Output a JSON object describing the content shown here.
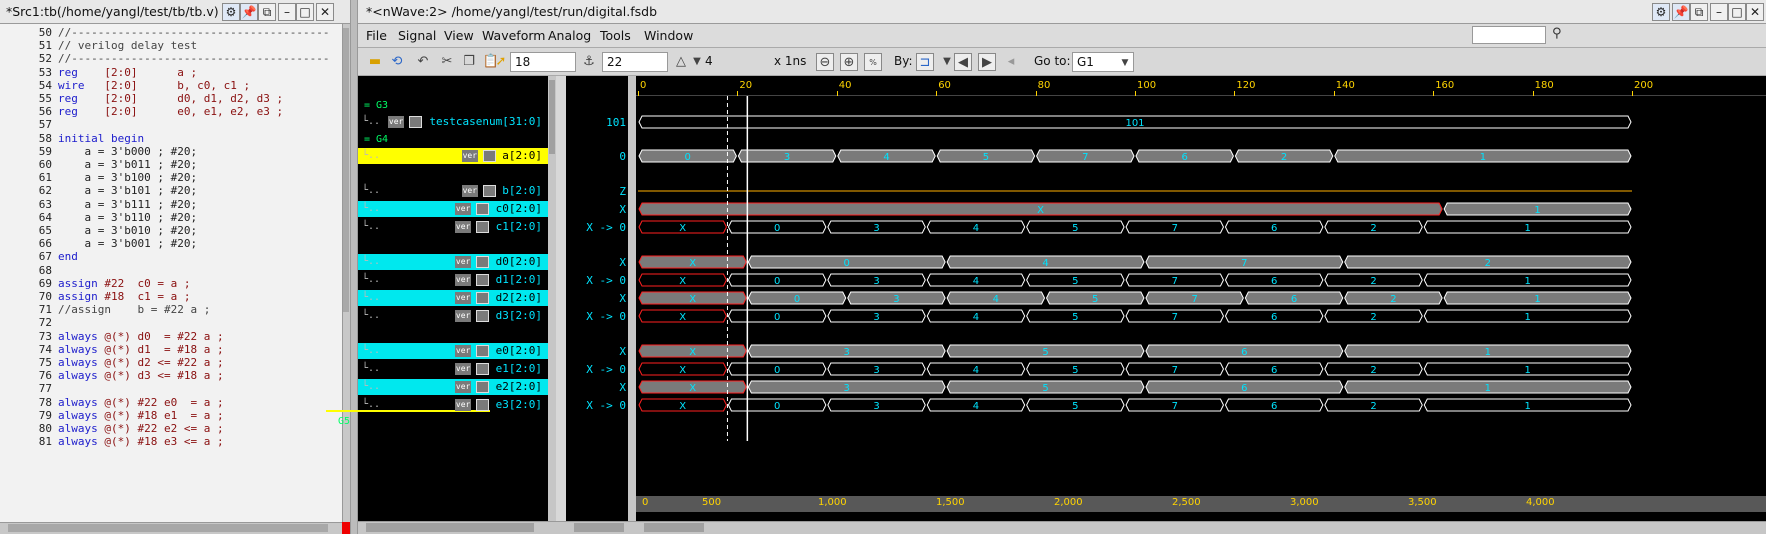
{
  "source_window": {
    "title": "*Src1:tb(/home/yangl/test/tb/tb.v)",
    "lines": [
      {
        "num": "50",
        "segments": [
          {
            "t": "//---------------------------------------",
            "c": "cm"
          }
        ]
      },
      {
        "num": "51",
        "segments": [
          {
            "t": "// verilog delay test",
            "c": "cm"
          }
        ]
      },
      {
        "num": "52",
        "segments": [
          {
            "t": "//---------------------------------------",
            "c": "cm"
          }
        ]
      },
      {
        "num": "53",
        "segments": [
          {
            "t": "reg",
            "c": "kw"
          },
          {
            "t": "    [2:0]      a ;",
            "c": "tx"
          }
        ]
      },
      {
        "num": "54",
        "segments": [
          {
            "t": "wire",
            "c": "kw"
          },
          {
            "t": "   [2:0]      b, c0, c1 ;",
            "c": "tx"
          }
        ]
      },
      {
        "num": "55",
        "segments": [
          {
            "t": "reg",
            "c": "kw"
          },
          {
            "t": "    [2:0]      d0, d1, d2, d3 ;",
            "c": "tx"
          }
        ]
      },
      {
        "num": "56",
        "segments": [
          {
            "t": "reg",
            "c": "kw"
          },
          {
            "t": "    [2:0]      e0, e1, e2, e3 ;",
            "c": "tx"
          }
        ]
      },
      {
        "num": "57",
        "segments": []
      },
      {
        "num": "58",
        "segments": [
          {
            "t": "initial begin",
            "c": "kw"
          }
        ]
      },
      {
        "num": "59",
        "segments": [
          {
            "t": "    a = 3'b000 ; #20;",
            "c": "nm"
          }
        ]
      },
      {
        "num": "60",
        "segments": [
          {
            "t": "    a = 3'b011 ; #20;",
            "c": "nm"
          }
        ]
      },
      {
        "num": "61",
        "segments": [
          {
            "t": "    a = 3'b100 ; #20;",
            "c": "nm"
          }
        ]
      },
      {
        "num": "62",
        "segments": [
          {
            "t": "    a = 3'b101 ; #20;",
            "c": "nm"
          }
        ]
      },
      {
        "num": "63",
        "segments": [
          {
            "t": "    a = 3'b111 ; #20;",
            "c": "nm"
          }
        ]
      },
      {
        "num": "64",
        "segments": [
          {
            "t": "    a = 3'b110 ; #20;",
            "c": "nm"
          }
        ]
      },
      {
        "num": "65",
        "segments": [
          {
            "t": "    a = 3'b010 ; #20;",
            "c": "nm"
          }
        ]
      },
      {
        "num": "66",
        "segments": [
          {
            "t": "    a = 3'b001 ; #20;",
            "c": "nm"
          }
        ]
      },
      {
        "num": "67",
        "segments": [
          {
            "t": "end",
            "c": "kw"
          }
        ]
      },
      {
        "num": "68",
        "segments": []
      },
      {
        "num": "69",
        "segments": [
          {
            "t": "assign",
            "c": "kw"
          },
          {
            "t": " #22  c0 = a ;",
            "c": "tx"
          }
        ]
      },
      {
        "num": "70",
        "segments": [
          {
            "t": "assign",
            "c": "kw"
          },
          {
            "t": " #18  c1 = a ;",
            "c": "tx"
          }
        ]
      },
      {
        "num": "71",
        "segments": [
          {
            "t": "//assign    b = #22 a ;",
            "c": "cm"
          }
        ]
      },
      {
        "num": "72",
        "segments": []
      },
      {
        "num": "73",
        "segments": [
          {
            "t": "always",
            "c": "kw"
          },
          {
            "t": " @(*) d0  = #22 a ;",
            "c": "tx"
          }
        ]
      },
      {
        "num": "74",
        "segments": [
          {
            "t": "always",
            "c": "kw"
          },
          {
            "t": " @(*) d1  = #18 a ;",
            "c": "tx"
          }
        ]
      },
      {
        "num": "75",
        "segments": [
          {
            "t": "always",
            "c": "kw"
          },
          {
            "t": " @(*) d2 <= #22 a ;",
            "c": "tx"
          }
        ]
      },
      {
        "num": "76",
        "segments": [
          {
            "t": "always",
            "c": "kw"
          },
          {
            "t": " @(*) d3 <= #18 a ;",
            "c": "tx"
          }
        ]
      },
      {
        "num": "77",
        "segments": []
      },
      {
        "num": "78",
        "segments": [
          {
            "t": "always",
            "c": "kw"
          },
          {
            "t": " @(*) #22 e0  = a ;",
            "c": "tx"
          }
        ]
      },
      {
        "num": "79",
        "segments": [
          {
            "t": "always",
            "c": "kw"
          },
          {
            "t": " @(*) #18 e1  = a ;",
            "c": "tx"
          }
        ]
      },
      {
        "num": "80",
        "segments": [
          {
            "t": "always",
            "c": "kw"
          },
          {
            "t": " @(*) #22 e2 <= a ;",
            "c": "tx"
          }
        ]
      },
      {
        "num": "81",
        "segments": [
          {
            "t": "always",
            "c": "kw"
          },
          {
            "t": " @(*) #18 e3 <= a ;",
            "c": "tx"
          }
        ]
      }
    ]
  },
  "wave_window": {
    "title": "*<nWave:2> /home/yangl/test/run/digital.fsdb",
    "menus": [
      "File",
      "Signal",
      "View",
      "Waveform",
      "Analog",
      "Tools",
      "Window"
    ],
    "toolbar": {
      "cursor_time": "18",
      "marker_time": "22",
      "delta": "4",
      "time_unit": "x 1ns",
      "by_label": "By:",
      "goto_label": "Go to:",
      "goto_value": "G1"
    },
    "groups": [
      "= G3",
      "= G4",
      "G5"
    ],
    "signals": [
      {
        "name": "testcasenum[31:0]",
        "value": "101",
        "hl": ""
      },
      {
        "name": "a[2:0]",
        "value": "0",
        "hl": "hy"
      },
      {
        "name": "b[2:0]",
        "value": "Z",
        "hl": ""
      },
      {
        "name": "c0[2:0]",
        "value": "X",
        "hl": "hc"
      },
      {
        "name": "c1[2:0]",
        "value": "X -> 0",
        "hl": ""
      },
      {
        "name": "d0[2:0]",
        "value": "X",
        "hl": "hc"
      },
      {
        "name": "d1[2:0]",
        "value": "X -> 0",
        "hl": ""
      },
      {
        "name": "d2[2:0]",
        "value": "X",
        "hl": "hc"
      },
      {
        "name": "d3[2:0]",
        "value": "X -> 0",
        "hl": ""
      },
      {
        "name": "e0[2:0]",
        "value": "X",
        "hl": "hc"
      },
      {
        "name": "e1[2:0]",
        "value": "X -> 0",
        "hl": ""
      },
      {
        "name": "e2[2:0]",
        "value": "X",
        "hl": "hc"
      },
      {
        "name": "e3[2:0]",
        "value": "X -> 0",
        "hl": ""
      }
    ],
    "sig_tag": "ver",
    "ruler_ticks": [
      "0",
      "20",
      "40",
      "60",
      "80",
      "100",
      "120",
      "140",
      "160",
      "180",
      "200"
    ],
    "bottom_ticks": [
      "0",
      "500",
      "1,000",
      "1,500",
      "2,000",
      "2,500",
      "3,000",
      "3,500",
      "4,000"
    ],
    "wave_segments": {
      "testcasenum": [
        {
          "from": 0,
          "to": 200,
          "v": "101"
        }
      ],
      "a": [
        {
          "from": 0,
          "to": 20,
          "v": "0"
        },
        {
          "from": 20,
          "to": 40,
          "v": "3"
        },
        {
          "from": 40,
          "to": 60,
          "v": "4"
        },
        {
          "from": 60,
          "to": 80,
          "v": "5"
        },
        {
          "from": 80,
          "to": 100,
          "v": "7"
        },
        {
          "from": 100,
          "to": 120,
          "v": "6"
        },
        {
          "from": 120,
          "to": 140,
          "v": "2"
        },
        {
          "from": 140,
          "to": 200,
          "v": "1"
        }
      ],
      "c0": [
        {
          "from": 0,
          "to": 162,
          "v": "X",
          "x": true
        },
        {
          "from": 162,
          "to": 200,
          "v": "1"
        }
      ],
      "c1": [
        {
          "from": 0,
          "to": 18,
          "v": "X",
          "x": true,
          "o": true
        },
        {
          "from": 18,
          "to": 38,
          "v": "0",
          "o": true
        },
        {
          "from": 38,
          "to": 58,
          "v": "3",
          "o": true
        },
        {
          "from": 58,
          "to": 78,
          "v": "4",
          "o": true
        },
        {
          "from": 78,
          "to": 98,
          "v": "5",
          "o": true
        },
        {
          "from": 98,
          "to": 118,
          "v": "7",
          "o": true
        },
        {
          "from": 118,
          "to": 138,
          "v": "6",
          "o": true
        },
        {
          "from": 138,
          "to": 158,
          "v": "2",
          "o": true
        },
        {
          "from": 158,
          "to": 200,
          "v": "1",
          "o": true
        }
      ],
      "d0": [
        {
          "from": 0,
          "to": 22,
          "v": "X",
          "x": true
        },
        {
          "from": 22,
          "to": 62,
          "v": "0"
        },
        {
          "from": 62,
          "to": 102,
          "v": "4"
        },
        {
          "from": 102,
          "to": 142,
          "v": "7"
        },
        {
          "from": 142,
          "to": 200,
          "v": "2"
        }
      ],
      "d1": [
        {
          "from": 0,
          "to": 18,
          "v": "X",
          "x": true,
          "o": true
        },
        {
          "from": 18,
          "to": 38,
          "v": "0",
          "o": true
        },
        {
          "from": 38,
          "to": 58,
          "v": "3",
          "o": true
        },
        {
          "from": 58,
          "to": 78,
          "v": "4",
          "o": true
        },
        {
          "from": 78,
          "to": 98,
          "v": "5",
          "o": true
        },
        {
          "from": 98,
          "to": 118,
          "v": "7",
          "o": true
        },
        {
          "from": 118,
          "to": 138,
          "v": "6",
          "o": true
        },
        {
          "from": 138,
          "to": 158,
          "v": "2",
          "o": true
        },
        {
          "from": 158,
          "to": 200,
          "v": "1",
          "o": true
        }
      ],
      "d2": [
        {
          "from": 0,
          "to": 22,
          "v": "X",
          "x": true
        },
        {
          "from": 22,
          "to": 42,
          "v": "0"
        },
        {
          "from": 42,
          "to": 62,
          "v": "3"
        },
        {
          "from": 62,
          "to": 82,
          "v": "4"
        },
        {
          "from": 82,
          "to": 102,
          "v": "5"
        },
        {
          "from": 102,
          "to": 122,
          "v": "7"
        },
        {
          "from": 122,
          "to": 142,
          "v": "6"
        },
        {
          "from": 142,
          "to": 162,
          "v": "2"
        },
        {
          "from": 162,
          "to": 200,
          "v": "1"
        }
      ],
      "d3": [
        {
          "from": 0,
          "to": 18,
          "v": "X",
          "x": true,
          "o": true
        },
        {
          "from": 18,
          "to": 38,
          "v": "0",
          "o": true
        },
        {
          "from": 38,
          "to": 58,
          "v": "3",
          "o": true
        },
        {
          "from": 58,
          "to": 78,
          "v": "4",
          "o": true
        },
        {
          "from": 78,
          "to": 98,
          "v": "5",
          "o": true
        },
        {
          "from": 98,
          "to": 118,
          "v": "7",
          "o": true
        },
        {
          "from": 118,
          "to": 138,
          "v": "6",
          "o": true
        },
        {
          "from": 138,
          "to": 158,
          "v": "2",
          "o": true
        },
        {
          "from": 158,
          "to": 200,
          "v": "1",
          "o": true
        }
      ],
      "e0": [
        {
          "from": 0,
          "to": 22,
          "v": "X",
          "x": true
        },
        {
          "from": 22,
          "to": 62,
          "v": "3"
        },
        {
          "from": 62,
          "to": 102,
          "v": "5"
        },
        {
          "from": 102,
          "to": 142,
          "v": "6"
        },
        {
          "from": 142,
          "to": 200,
          "v": "1"
        }
      ],
      "e1": [
        {
          "from": 0,
          "to": 18,
          "v": "X",
          "x": true,
          "o": true
        },
        {
          "from": 18,
          "to": 38,
          "v": "0",
          "o": true
        },
        {
          "from": 38,
          "to": 58,
          "v": "3",
          "o": true
        },
        {
          "from": 58,
          "to": 78,
          "v": "4",
          "o": true
        },
        {
          "from": 78,
          "to": 98,
          "v": "5",
          "o": true
        },
        {
          "from": 98,
          "to": 118,
          "v": "7",
          "o": true
        },
        {
          "from": 118,
          "to": 138,
          "v": "6",
          "o": true
        },
        {
          "from": 138,
          "to": 158,
          "v": "2",
          "o": true
        },
        {
          "from": 158,
          "to": 200,
          "v": "1",
          "o": true
        }
      ],
      "e2": [
        {
          "from": 0,
          "to": 22,
          "v": "X",
          "x": true
        },
        {
          "from": 22,
          "to": 62,
          "v": "3"
        },
        {
          "from": 62,
          "to": 102,
          "v": "5"
        },
        {
          "from": 102,
          "to": 142,
          "v": "6"
        },
        {
          "from": 142,
          "to": 200,
          "v": "1"
        }
      ],
      "e3": [
        {
          "from": 0,
          "to": 18,
          "v": "X",
          "x": true,
          "o": true
        },
        {
          "from": 18,
          "to": 38,
          "v": "0",
          "o": true
        },
        {
          "from": 38,
          "to": 58,
          "v": "3",
          "o": true
        },
        {
          "from": 58,
          "to": 78,
          "v": "4",
          "o": true
        },
        {
          "from": 78,
          "to": 98,
          "v": "5",
          "o": true
        },
        {
          "from": 98,
          "to": 118,
          "v": "7",
          "o": true
        },
        {
          "from": 118,
          "to": 138,
          "v": "6",
          "o": true
        },
        {
          "from": 138,
          "to": 158,
          "v": "2",
          "o": true
        },
        {
          "from": 158,
          "to": 200,
          "v": "1",
          "o": true
        }
      ]
    },
    "cursor_ns": 18,
    "marker_ns": 22
  },
  "colors": {
    "wave_fill": "#7a7a7a",
    "wave_line": "#ffffff",
    "x_red": "#ff2020",
    "cursor": "#ffffff",
    "text": "#00e4ff",
    "ruler": "#ffd400"
  }
}
